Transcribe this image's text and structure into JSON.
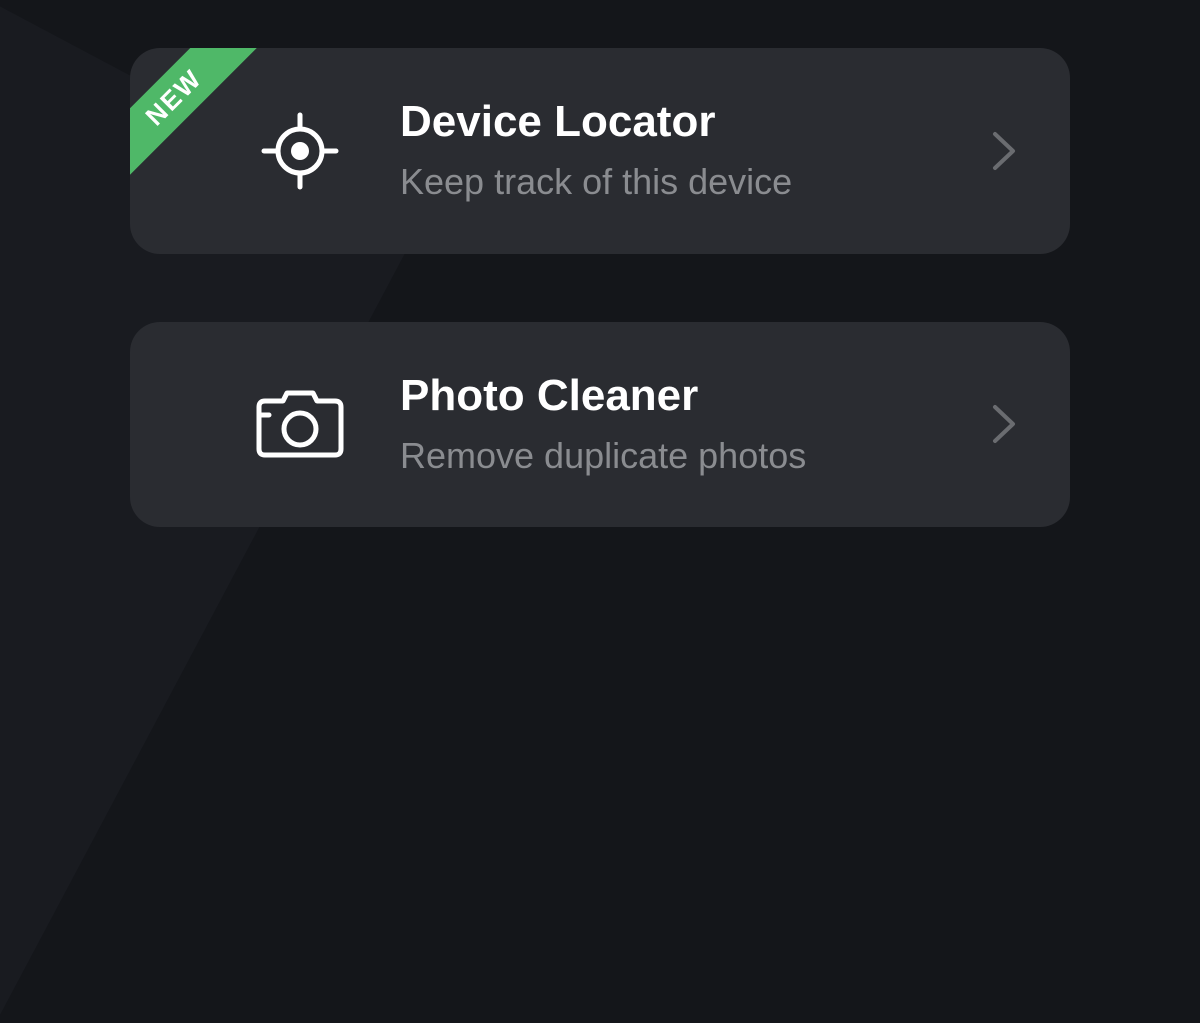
{
  "cards": [
    {
      "badge": "NEW",
      "title": "Device Locator",
      "subtitle": "Keep track of this device",
      "icon": "crosshair-icon"
    },
    {
      "badge": null,
      "title": "Photo Cleaner",
      "subtitle": "Remove duplicate photos",
      "icon": "camera-icon"
    }
  ],
  "colors": {
    "background": "#14161a",
    "card": "#2a2c31",
    "badge": "#4fb868",
    "title": "#ffffff",
    "subtitle": "#8a8c90",
    "chevron": "#6a6c70"
  }
}
